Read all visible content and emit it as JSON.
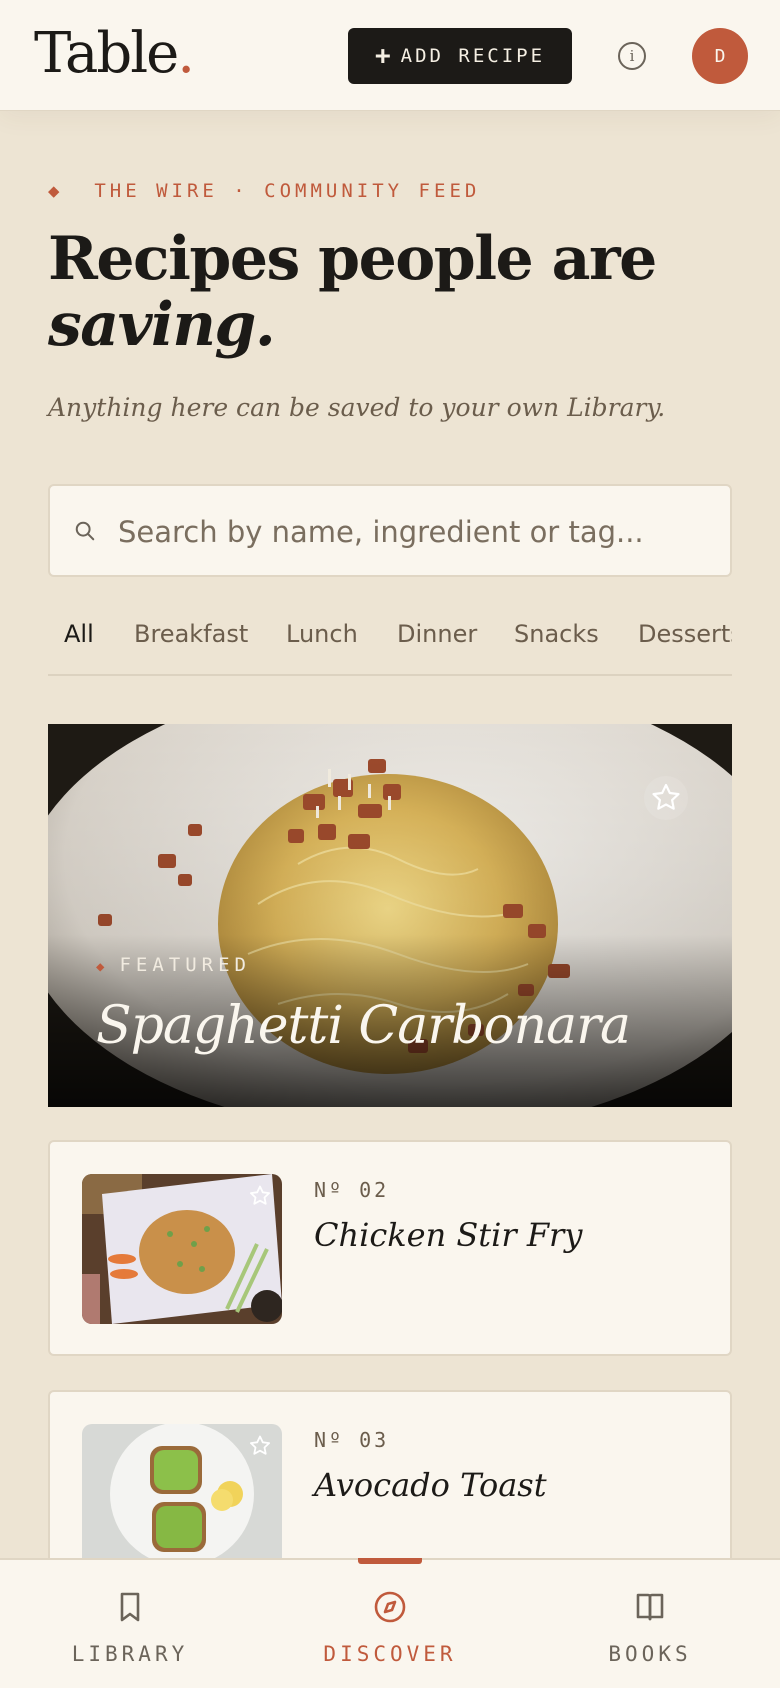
{
  "header": {
    "logo_text": "Table",
    "logo_dot": ".",
    "add_recipe_label": "ADD RECIPE",
    "info_icon": "info-icon",
    "avatar_initial": "D"
  },
  "hero": {
    "kicker": "THE WIRE · COMMUNITY FEED",
    "kicker_icon": "◆",
    "title_line1": "Recipes people are",
    "title_line2": "saving.",
    "subtitle": "Anything here can be saved to your own Library."
  },
  "search": {
    "placeholder": "Search by name, ingredient or tag...",
    "value": ""
  },
  "tabs": [
    {
      "label": "All",
      "active": true
    },
    {
      "label": "Breakfast",
      "active": false
    },
    {
      "label": "Lunch",
      "active": false
    },
    {
      "label": "Dinner",
      "active": false
    },
    {
      "label": "Snacks",
      "active": false
    },
    {
      "label": "Desserts",
      "active": false
    }
  ],
  "featured": {
    "label": "FEATURED",
    "name": "Spaghetti Carbonara"
  },
  "recipes": [
    {
      "number": "Nº 02",
      "name": "Chicken Stir Fry"
    },
    {
      "number": "Nº 03",
      "name": "Avocado Toast"
    }
  ],
  "bottom_nav": [
    {
      "label": "LIBRARY",
      "icon": "bookmark-icon",
      "active": false
    },
    {
      "label": "DISCOVER",
      "icon": "compass-icon",
      "active": true
    },
    {
      "label": "BOOKS",
      "icon": "book-icon",
      "active": false
    }
  ],
  "colors": {
    "accent": "#c05a3c",
    "background": "#ede4d3",
    "surface": "#faf6ee",
    "ink": "#1c1a17"
  }
}
